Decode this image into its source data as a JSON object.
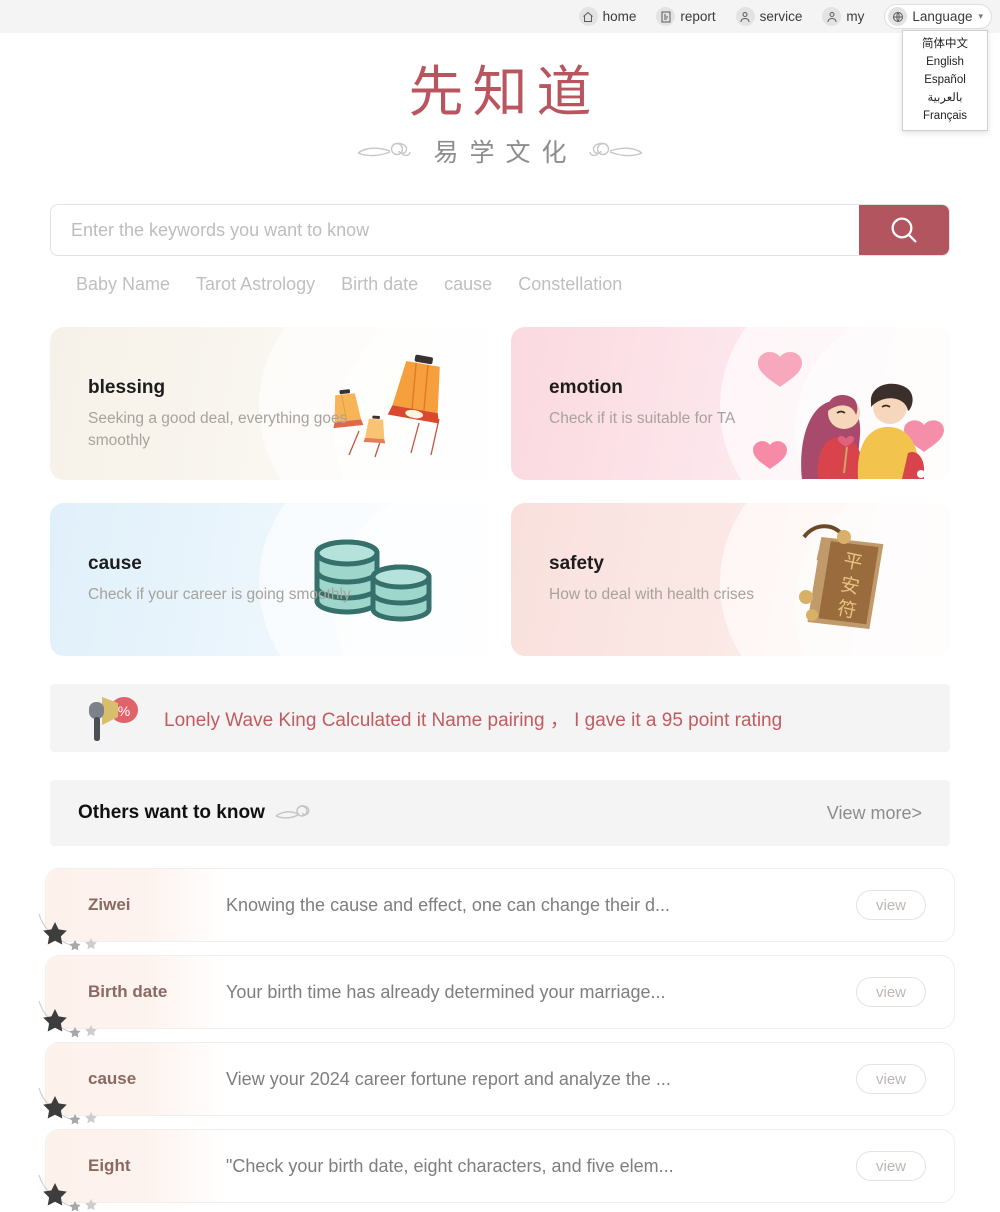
{
  "topnav": {
    "items": [
      {
        "label": "home",
        "icon": "home-icon"
      },
      {
        "label": "report",
        "icon": "report-icon"
      },
      {
        "label": "service",
        "icon": "service-icon"
      },
      {
        "label": "my",
        "icon": "user-icon"
      }
    ],
    "language": {
      "label": "Language",
      "icon": "globe-icon",
      "caret": "▾",
      "options": [
        "简体中文",
        "English",
        "Español",
        "بالعربية",
        "Français"
      ]
    }
  },
  "logo": {
    "main": "先知道",
    "sub": "易学文化",
    "main_color": "#b9555f",
    "sub_color": "#8d8d8d"
  },
  "search": {
    "placeholder": "Enter the keywords you want to know",
    "value": "",
    "button_icon": "search-icon",
    "button_color": "#b3555f",
    "hot_keywords": [
      "Baby Name",
      "Tarot Astrology",
      "Birth date",
      "cause",
      "Constellation"
    ]
  },
  "cards": [
    {
      "title": "blessing",
      "desc": "Seeking a good deal, everything goes smoothly",
      "art": "lanterns-illustration",
      "accent": "#f6f1e8"
    },
    {
      "title": "emotion",
      "desc": "Check if it is suitable for TA",
      "art": "couple-hearts-illustration",
      "accent": "#fbd9e0"
    },
    {
      "title": "cause",
      "desc": "Check if your career is going smoothly",
      "art": "coin-stacks-illustration",
      "accent": "#e0f0fa"
    },
    {
      "title": "safety",
      "desc": "How to deal with health crises",
      "art": "peace-amulet-illustration",
      "accent": "#f9e0dd"
    }
  ],
  "announcement": {
    "icon": "megaphone-percent-icon",
    "text": "Lonely Wave King Calculated it  Name pairing ，  I gave it a 95 point rating",
    "color": "#c05c60"
  },
  "section": {
    "title": "Others want to know",
    "ornament": "cloud-icon",
    "view_more": "View more>"
  },
  "list": {
    "view_label": "view",
    "items": [
      {
        "tag": "Ziwei",
        "text": "Knowing the cause and effect, one can change their d..."
      },
      {
        "tag": "Birth date",
        "text": "Your birth time has already determined your marriage..."
      },
      {
        "tag": "cause",
        "text": "View your 2024 career fortune report and analyze the ..."
      },
      {
        "tag": "Eight",
        "text": "\"Check your birth date, eight characters, and five elem..."
      }
    ]
  }
}
